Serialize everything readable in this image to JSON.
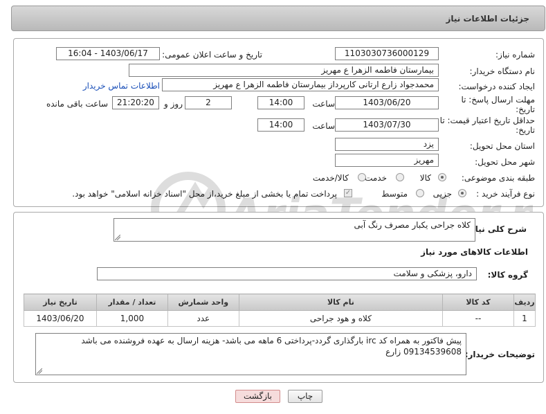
{
  "header": {
    "title": "جزئیات اطلاعات نیاز"
  },
  "form": {
    "need_number_label": "شماره نیاز:",
    "need_number": "1103030736000129",
    "announce_label": "تاریخ و ساعت اعلان عمومی:",
    "announce_value": "1403/06/17 - 16:04",
    "buyer_org_label": "نام دستگاه خریدار:",
    "buyer_org": "بیمارستان فاطمه الزهرا ع  مهریز",
    "requester_label": "ایجاد کننده درخواست:",
    "requester": "محمدجواد زارع ارتانی کارپرداز بیمارستان فاطمه الزهرا ع  مهریز",
    "contact_link": "اطلاعات تماس خریدار",
    "deadline_label_1": "مهلت ارسال پاسخ: تا",
    "deadline_label_2": "تاریخ:",
    "deadline_date": "1403/06/20",
    "time_label": "ساعت",
    "deadline_time": "14:00",
    "days_value": "2",
    "days_label": "روز و",
    "remaining_time": "21:20:20",
    "remaining_label": "ساعت باقی مانده",
    "validity_label_1": "حداقل تاریخ اعتبار قیمت: تا",
    "validity_label_2": "تاریخ:",
    "validity_date": "1403/07/30",
    "validity_time": "14:00",
    "province_label": "استان محل تحویل:",
    "province": "یزد",
    "city_label": "شهر محل تحویل:",
    "city": "مهریز",
    "category_label": "طبقه بندی موضوعی:",
    "category_options": [
      "کالا",
      "خدمت",
      "کالا/خدمت"
    ],
    "process_label": "نوع فرآیند خرید :",
    "process_options": [
      "جزیی",
      "متوسط"
    ],
    "payment_note": "پرداخت تمام یا بخشی از مبلغ خرید،از محل \"اسناد خزانه اسلامی\" خواهد بود."
  },
  "details": {
    "summary_label": "شرح کلی نیاز:",
    "summary": "کلاه جراحی یکبار مصرف رنگ آبی",
    "goods_info_title": "اطلاعات کالاهای مورد نیاز",
    "goods_group_label": "گروه کالا:",
    "goods_group": "دارو، پزشکی و سلامت",
    "table": {
      "headers": [
        "ردیف",
        "کد کالا",
        "نام کالا",
        "واحد شمارش",
        "تعداد / مقدار",
        "تاریخ نیاز"
      ],
      "rows": [
        [
          "1",
          "--",
          "کلاه و هود جراحی",
          "عدد",
          "1,000",
          "1403/06/20"
        ]
      ]
    },
    "buyer_notes_label": "توضیحات خریدار:",
    "buyer_notes_line1": "پیش فاکتور به همراه کد irc بارگذاری گردد-پرداختی 6 ماهه می باشد- هزینه ارسال به عهده فروشنده می باشد",
    "buyer_notes_line2": "09134539608 زارع"
  },
  "buttons": {
    "print": "چاپ",
    "back": "بازگشت"
  },
  "watermark_text": "AriaTender.neT",
  "colors": {
    "link": "#1a4fb8",
    "back_bg": "#f6dcdc",
    "back_border": "#d28b8b"
  }
}
